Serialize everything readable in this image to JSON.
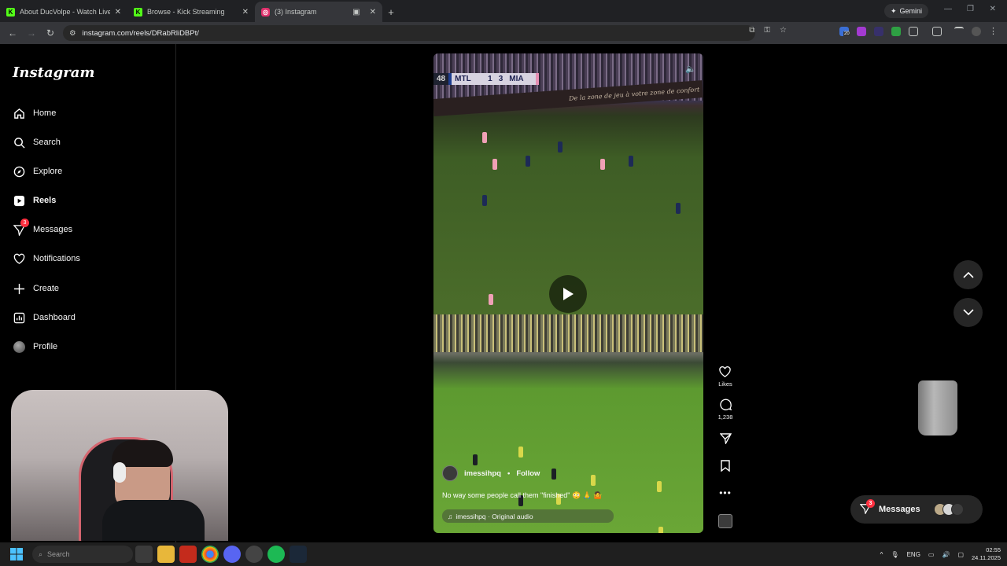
{
  "browser": {
    "tabs": [
      {
        "title": "About DucVolpe - Watch Live o",
        "favicon": "K",
        "active": false
      },
      {
        "title": "Browse - Kick Streaming",
        "favicon": "K",
        "active": false
      },
      {
        "title": "(3) Instagram",
        "favicon": "ig",
        "active": true
      }
    ],
    "gemini_label": "Gemini",
    "url": "instagram.com/reels/DRabRliDBPt/",
    "extension_badge": "20"
  },
  "sidebar": {
    "logo": "Instagram",
    "items": [
      {
        "label": "Home",
        "icon": "home-icon"
      },
      {
        "label": "Search",
        "icon": "search-icon"
      },
      {
        "label": "Explore",
        "icon": "compass-icon"
      },
      {
        "label": "Reels",
        "icon": "reels-icon",
        "active": true
      },
      {
        "label": "Messages",
        "icon": "messenger-icon",
        "badge": "3"
      },
      {
        "label": "Notifications",
        "icon": "heart-icon"
      },
      {
        "label": "Create",
        "icon": "plus-icon"
      },
      {
        "label": "Dashboard",
        "icon": "dashboard-icon"
      },
      {
        "label": "Profile",
        "icon": "avatar-icon"
      }
    ]
  },
  "reel": {
    "scoreboard": {
      "minute": "48",
      "home": "MTL",
      "home_score": "1",
      "away_score": "3",
      "away": "MIA"
    },
    "adboard_text": "De la zone de jeu à votre zone de confort",
    "author": "imessihpq",
    "follow_label": "Follow",
    "separator": "•",
    "caption": "No way some people call them \"finished\" 😳 🙏 🤷",
    "audio": "imessihpq · Original audio"
  },
  "actions": {
    "likes_label": "Likes",
    "comments_count": "1,238"
  },
  "messages_pill": {
    "label": "Messages",
    "badge": "3"
  },
  "taskbar": {
    "search_placeholder": "Search",
    "language": "ENG",
    "time": "02:55",
    "date": "24.11.2025"
  },
  "colors": {
    "instagram_bg": "#000000",
    "badge_red": "#ff3040",
    "kick_green": "#53fc18"
  }
}
